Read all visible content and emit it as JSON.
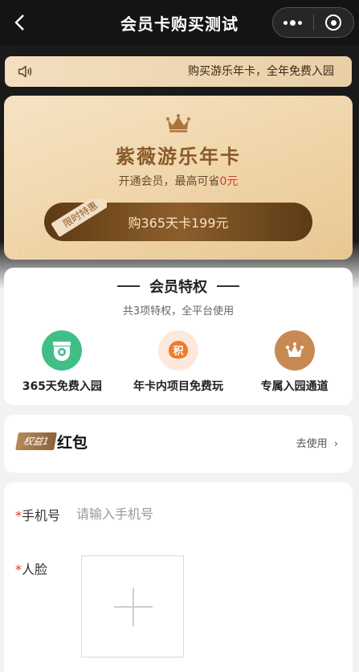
{
  "nav": {
    "title": "会员卡购买测试",
    "back_icon": "chevron-left-icon",
    "more_icon": "more-dots-icon",
    "close_icon": "target-circle-icon"
  },
  "notice": {
    "icon": "speaker-icon",
    "text": "购买游乐年卡，全年免费入园"
  },
  "card": {
    "icon": "crown-icon",
    "title": "紫薇游乐年卡",
    "subtitle_prefix": "开通会员，最高可省",
    "subtitle_amount": "0元",
    "ribbon": "限时特惠",
    "buy_label": "购365天卡199元"
  },
  "privileges": {
    "title": "会员特权",
    "subtitle": "共3项特权，全平台使用",
    "items": [
      {
        "label": "365天免费入园",
        "icon": "camera-icon",
        "color": "#3fbf86"
      },
      {
        "label": "年卡内项目免费玩",
        "icon": "points-icon",
        "color": "#f07b2c"
      },
      {
        "label": "专属入园通道",
        "icon": "crown-badge-icon",
        "color": "#c88a52"
      }
    ]
  },
  "benefit": {
    "tag": "权益1",
    "name": "红包",
    "action": "去使用"
  },
  "form": {
    "phone_label": "手机号",
    "phone_placeholder": "请输入手机号",
    "phone_value": "",
    "face_label": "人脸",
    "required_mark": "*",
    "upload_icon": "plus-icon"
  },
  "colors": {
    "accent_gold": "#8b5a2b",
    "button_brown": "#6b4520",
    "required_red": "#d9382b"
  }
}
